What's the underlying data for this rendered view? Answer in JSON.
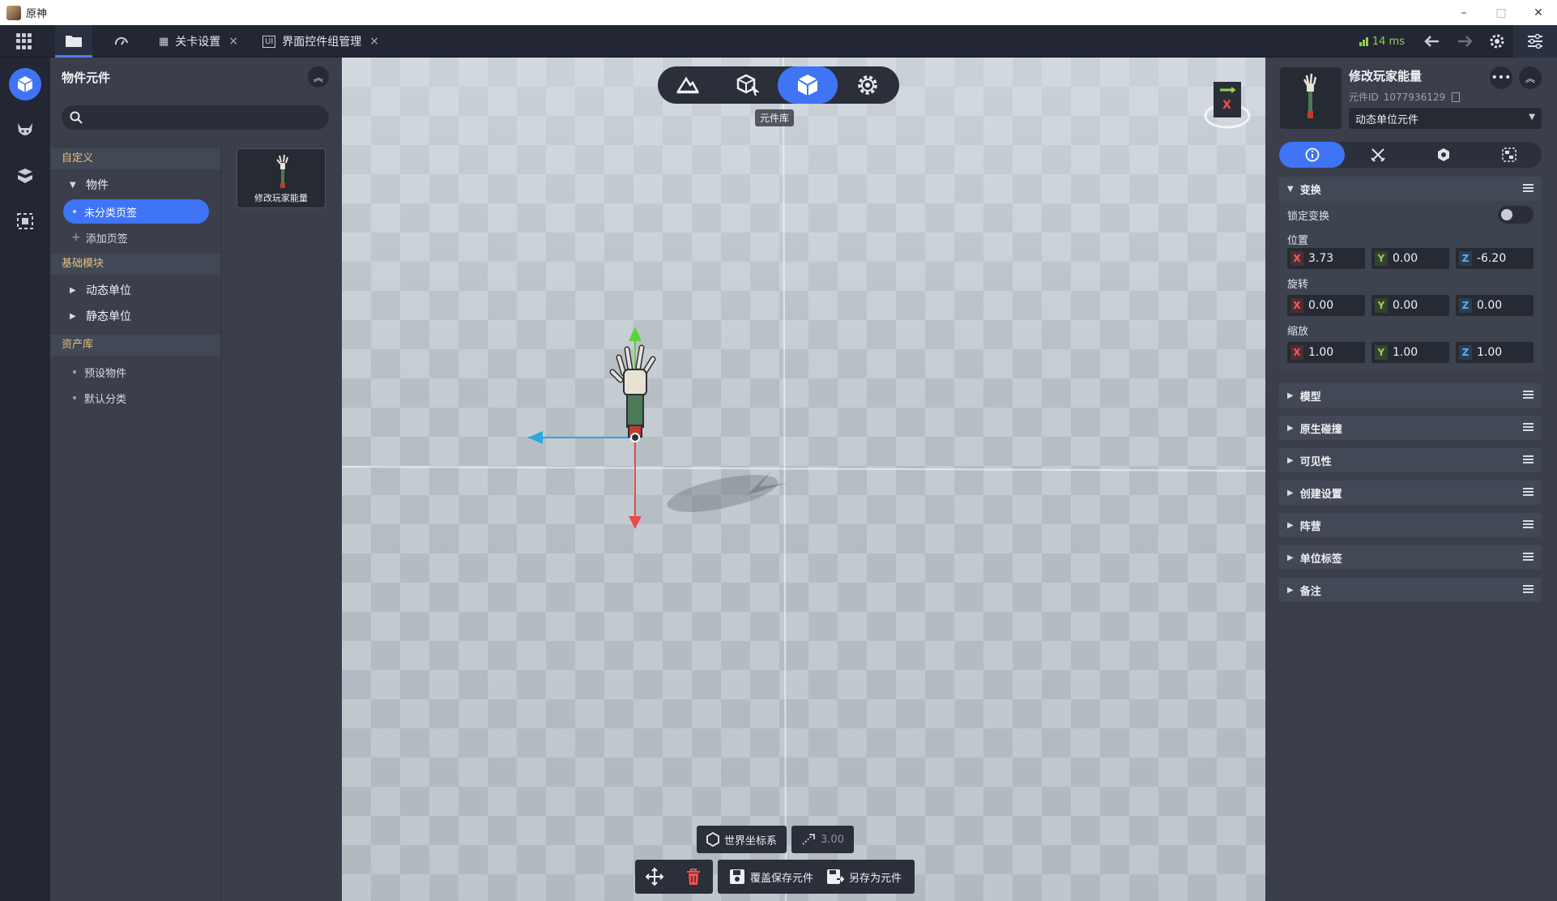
{
  "window": {
    "title": "原神",
    "minimize": "–",
    "maximize": "□",
    "close": "✕"
  },
  "topbar": {
    "tabs": [
      {
        "label": "关卡设置",
        "close": "×"
      },
      {
        "label": "界面控件组管理",
        "badge": "UI",
        "close": "×"
      }
    ],
    "ping": "14 ms"
  },
  "left_panel": {
    "title": "物件元件",
    "search": {
      "value": "",
      "placeholder": ""
    },
    "tree": {
      "custom_section": "自定义",
      "object_node": "物件",
      "uncategorized": "未分类页签",
      "add_tab": "添加页签",
      "basic_section": "基础模块",
      "dynamic_unit": "动态单位",
      "static_unit": "静态单位",
      "asset_section": "资产库",
      "preset_objects": "预设物件",
      "default_category": "默认分类"
    },
    "thumb_label": "修改玩家能量"
  },
  "viewport": {
    "mode_tooltip": "元件库",
    "coord_system": "世界坐标系",
    "snap_value": "3.00",
    "overwrite_save": "覆盖保存元件",
    "save_as": "另存为元件",
    "gizmo_label": "X"
  },
  "right_panel": {
    "name": "修改玩家能量",
    "id_label": "元件ID",
    "id_value": "1077936129",
    "type": "动态单位元件",
    "transform": {
      "title": "变换",
      "lock_label": "锁定变换",
      "lock_on": false,
      "position_label": "位置",
      "position": {
        "x": "3.73",
        "y": "0.00",
        "z": "-6.20"
      },
      "rotation_label": "旋转",
      "rotation": {
        "x": "0.00",
        "y": "0.00",
        "z": "0.00"
      },
      "scale_label": "缩放",
      "scale": {
        "x": "1.00",
        "y": "1.00",
        "z": "1.00"
      }
    },
    "sections": [
      "模型",
      "原生碰撞",
      "可见性",
      "创建设置",
      "阵营",
      "单位标签",
      "备注"
    ]
  },
  "axis_labels": {
    "x": "X",
    "y": "Y",
    "z": "Z"
  },
  "colors": {
    "accent": "#3f74f5",
    "axis_x": "#ff5a5a",
    "axis_y": "#8fd14f",
    "axis_z": "#4fb3ff",
    "section_heading": "#e4c17e"
  }
}
